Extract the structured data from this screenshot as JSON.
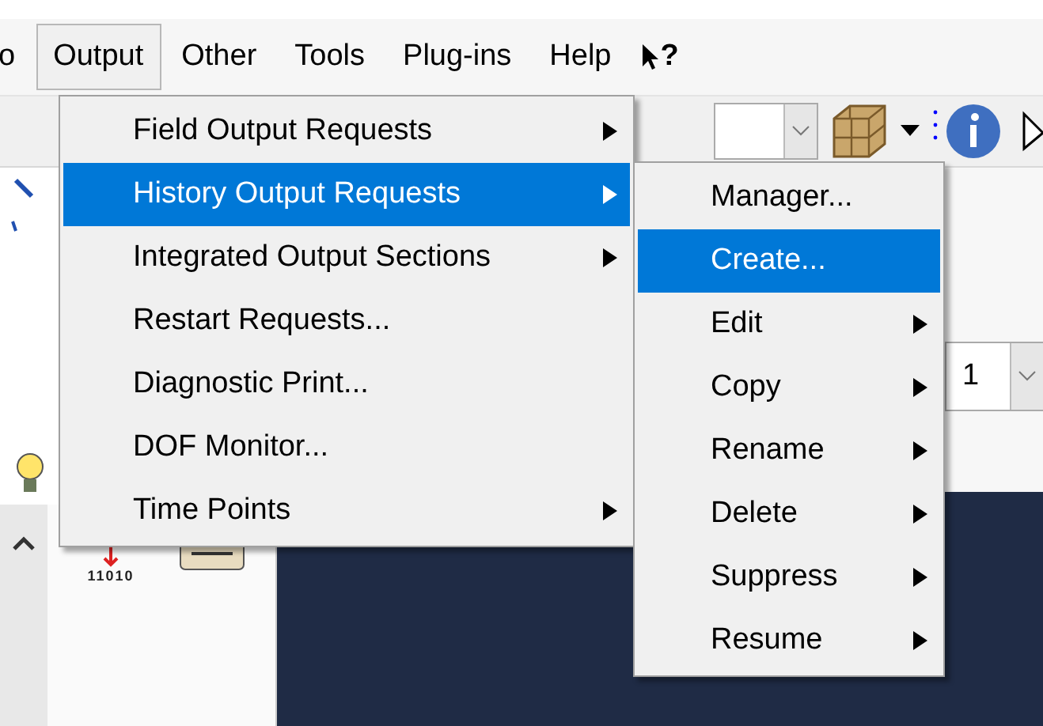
{
  "menubar": {
    "items": [
      {
        "label": "o",
        "selected": false
      },
      {
        "label": "Output",
        "selected": true
      },
      {
        "label": "Other",
        "selected": false
      },
      {
        "label": "Tools",
        "selected": false
      },
      {
        "label": "Plug-ins",
        "selected": false
      },
      {
        "label": "Help",
        "selected": false
      }
    ],
    "help_cursor_label": "?"
  },
  "step_combo": {
    "value": "1"
  },
  "tool_caption": "11010",
  "output_menu": {
    "items": [
      {
        "label": "Field Output Requests",
        "submenu": true,
        "selected": false
      },
      {
        "label": "History Output Requests",
        "submenu": true,
        "selected": true
      },
      {
        "label": "Integrated Output Sections",
        "submenu": true,
        "selected": false
      },
      {
        "label": "Restart Requests...",
        "submenu": false,
        "selected": false
      },
      {
        "label": "Diagnostic Print...",
        "submenu": false,
        "selected": false
      },
      {
        "label": "DOF Monitor...",
        "submenu": false,
        "selected": false
      },
      {
        "label": "Time Points",
        "submenu": true,
        "selected": false
      }
    ]
  },
  "history_submenu": {
    "items": [
      {
        "label": "Manager...",
        "submenu": false,
        "selected": false
      },
      {
        "label": "Create...",
        "submenu": false,
        "selected": true
      },
      {
        "label": "Edit",
        "submenu": true,
        "selected": false
      },
      {
        "label": "Copy",
        "submenu": true,
        "selected": false
      },
      {
        "label": "Rename",
        "submenu": true,
        "selected": false
      },
      {
        "label": "Delete",
        "submenu": true,
        "selected": false
      },
      {
        "label": "Suppress",
        "submenu": true,
        "selected": false
      },
      {
        "label": "Resume",
        "submenu": true,
        "selected": false
      }
    ]
  }
}
